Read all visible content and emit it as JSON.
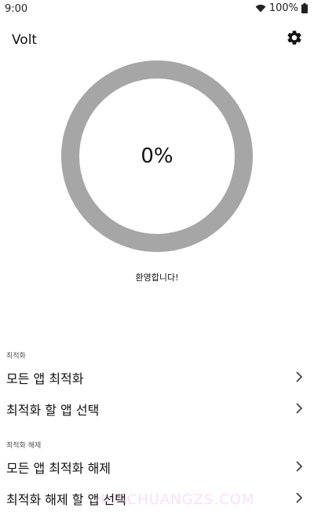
{
  "status_bar": {
    "time": "9:00",
    "battery_percent": "100%",
    "icons": [
      "wifi-icon",
      "battery-icon"
    ]
  },
  "app_bar": {
    "title": "Volt",
    "settings_icon": "gear-icon"
  },
  "progress": {
    "value_text": "0%",
    "value": 0,
    "ring_color": "#a6a6a6",
    "fill_color": "#4a90e2"
  },
  "welcome": "환영합니다!",
  "sections": [
    {
      "label": "최적화",
      "items": [
        "모든 앱 최적화",
        "최적화 할 앱 선택"
      ]
    },
    {
      "label": "최적화 해제",
      "items": [
        "모든 앱 최적화 해제",
        "최적화 해제 할 앱 선택"
      ]
    }
  ],
  "watermark": "HUACHUANGZS.COM"
}
